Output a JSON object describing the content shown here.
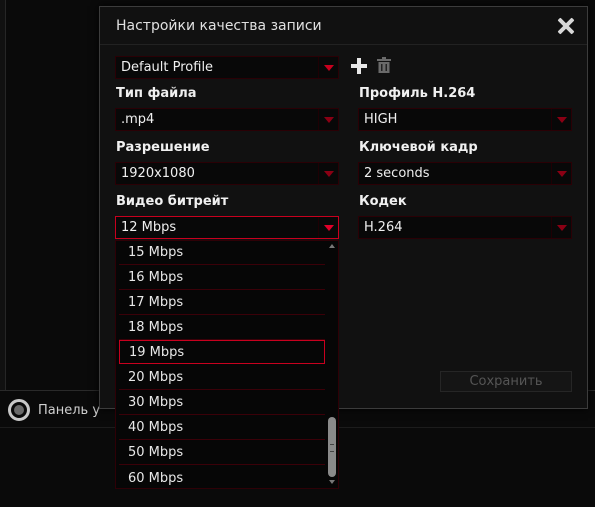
{
  "background": {
    "panel_label": "Панель у"
  },
  "dialog": {
    "title": "Настройки качества записи",
    "profile_value": "Default Profile",
    "file_type": {
      "label": "Тип файла",
      "value": ".mp4"
    },
    "h264_profile": {
      "label": "Профиль H.264",
      "value": "HIGH"
    },
    "resolution": {
      "label": "Разрешение",
      "value": "1920x1080"
    },
    "keyframe": {
      "label": "Ключевой кадр",
      "value": "2 seconds"
    },
    "video_bitrate": {
      "label": "Видео битрейт",
      "value": "12 Mbps"
    },
    "codec": {
      "label": "Кодек",
      "value": "H.264"
    },
    "save_label": "Сохранить"
  },
  "bitrate_dropdown": {
    "items": [
      "15 Mbps",
      "16 Mbps",
      "17 Mbps",
      "18 Mbps",
      "19 Mbps",
      "20 Mbps",
      "30 Mbps",
      "40 Mbps",
      "50 Mbps",
      "60 Mbps"
    ],
    "highlighted": "19 Mbps"
  },
  "colors": {
    "accent": "#c8001e",
    "dialog_bg": "#111111",
    "app_bg": "#0a0a0a"
  },
  "icons": [
    "close-icon",
    "plus-icon",
    "trash-icon",
    "chevron-down-icon",
    "panel-icon"
  ]
}
